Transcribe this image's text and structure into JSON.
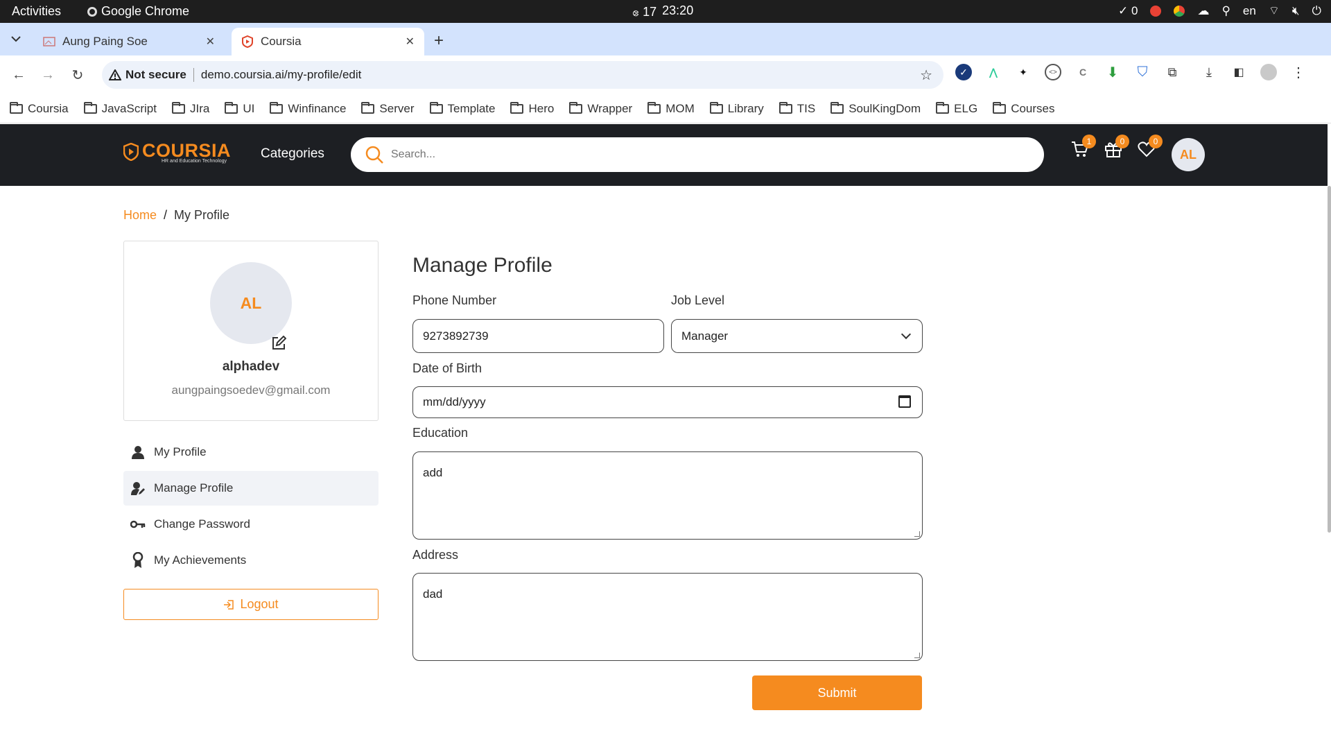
{
  "system_bar": {
    "activities": "Activities",
    "app_name": "Google Chrome",
    "date": "ဧ 17",
    "time": "23:20",
    "check_count": "0",
    "lang": "en"
  },
  "browser": {
    "tabs": [
      {
        "title": "Aung Paing Soe",
        "active": false
      },
      {
        "title": "Coursia",
        "active": true
      }
    ],
    "security_label": "Not secure",
    "url": "demo.coursia.ai/my-profile/edit",
    "bookmarks": [
      "Coursia",
      "JavaScript",
      "JIra",
      "UI",
      "Winfinance",
      "Server",
      "Template",
      "Hero",
      "Wrapper",
      "MOM",
      "Library",
      "TIS",
      "SoulKingDom",
      "ELG",
      "Courses"
    ]
  },
  "site": {
    "brand": "COURSIA",
    "tagline": "HR and Education Technology",
    "categories": "Categories",
    "search_placeholder": "Search...",
    "cart_count": "1",
    "gift_count": "0",
    "wishlist_count": "0",
    "user_initials": "AL",
    "accent_color": "#f58b1f"
  },
  "breadcrumb": {
    "home": "Home",
    "separator": "/",
    "current": "My Profile"
  },
  "profile": {
    "initials": "AL",
    "username": "alphadev",
    "email": "aungpaingsoedev@gmail.com"
  },
  "menu": [
    {
      "label": "My Profile",
      "active": false
    },
    {
      "label": "Manage Profile",
      "active": true
    },
    {
      "label": "Change Password",
      "active": false
    },
    {
      "label": "My Achievements",
      "active": false
    }
  ],
  "logout_label": "Logout",
  "form": {
    "title": "Manage Profile",
    "phone_label": "Phone Number",
    "phone_value": "9273892739",
    "job_level_label": "Job Level",
    "job_level_value": "Manager",
    "dob_label": "Date of Birth",
    "dob_placeholder": "mm/dd/yyyy",
    "education_label": "Education",
    "education_value": "add",
    "address_label": "Address",
    "address_value": "dad",
    "submit_label": "Submit"
  }
}
